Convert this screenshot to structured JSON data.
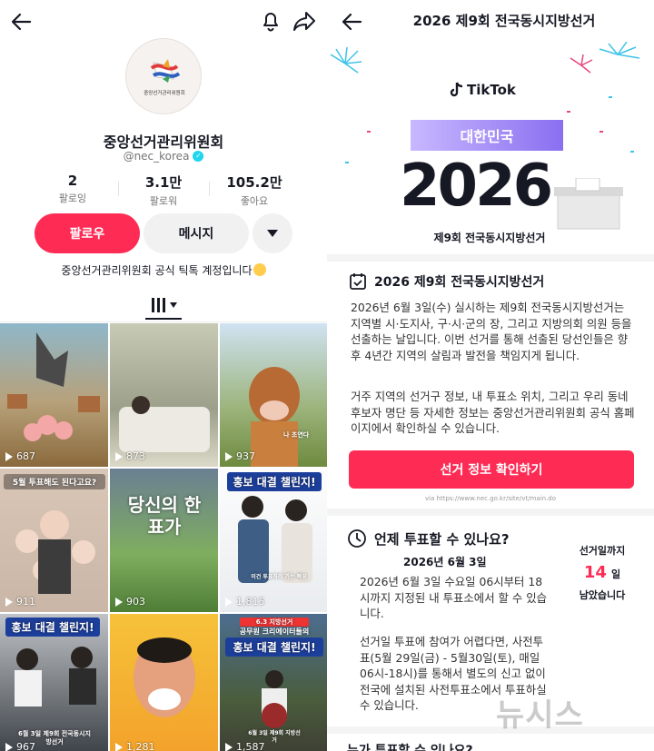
{
  "profile": {
    "name": "중앙선거관리위원회",
    "handle": "@nec_korea",
    "avatar_text": "중앙선거관리위원회",
    "stats": [
      {
        "value": "2",
        "label": "팔로잉"
      },
      {
        "value": "3.1만",
        "label": "팔로워"
      },
      {
        "value": "105.2만",
        "label": "좋아요"
      }
    ],
    "follow_label": "팔로우",
    "message_label": "메시지",
    "bio": "중앙선거관리위원회 공식 틱톡 계정입니다"
  },
  "videos": [
    {
      "views": "687"
    },
    {
      "views": "873"
    },
    {
      "views": "937",
      "caption": "나 초연다"
    },
    {
      "views": "911",
      "caption": "5월 투표해도 된다고요?"
    },
    {
      "views": "903",
      "caption": "당신의 한표가"
    },
    {
      "views": "1,815",
      "title": "홍보 대결 챌린지!",
      "caption": "이건 투표하러 가는 짝꿍"
    },
    {
      "views": "967",
      "title": "홍보 대결 챌린지!",
      "caption": "6월 3일 제9회 전국동시지방선거"
    },
    {
      "views": "1,281"
    },
    {
      "views": "1,587",
      "tag": "6.3 지방선거",
      "subtitle": "공무원 크리에이터들의",
      "title": "홍보 대결 챌린지!",
      "caption": "6월 3일 제9회 지방선거"
    }
  ],
  "event": {
    "page_title": "2026 제9회 전국동시지방선거",
    "brand": "TikTok",
    "banner_country": "대한민국",
    "banner_year": "2026",
    "banner_subtitle": "제9회 전국동시지방선거",
    "section1": {
      "title": "2026 제9회 전국동시지방선거",
      "para1": "2026년 6월 3일(수) 실시하는 제9회 전국동시지방선거는 지역별 시·도지사, 구·시·군의 장, 그리고 지방의회 의원 등을 선출하는 날입니다. 이번 선거를 통해 선출된 당선인들은 향후 4년간 지역의 살림과 발전을 책임지게 됩니다.",
      "para2": "거주 지역의 선거구 정보, 내 투표소 위치, 그리고 우리 동네 후보자 명단 등 자세한 정보는 중앙선거관리위원회 공식 홈페이지에서 확인하실 수 있습니다.",
      "cta": "선거 정보 확인하기",
      "url": "via https://www.nec.go.kr/site/vt/main.do"
    },
    "section2": {
      "title": "언제 투표할 수 있나요?",
      "date": "2026년 6월 3일",
      "para1": "2026년 6월 3일 수요일 06시부터 18시까지 지정된 내 투표소에서 할 수 있습니다.",
      "para2": "선거일 투표에 참여가 어렵다면, 사전투표(5월 29일(금) - 5월30일(토), 매일 06시-18시)를 통해서 별도의 신고 없이 전국에 설치된 사전투표소에서 투표하실 수 있습니다.",
      "dday_prefix": "선거일까지",
      "dday_number": "14",
      "dday_unit": "일",
      "dday_suffix": "남았습니다"
    },
    "section3_title": "누가 투표할 수 있나요?"
  },
  "watermark": "뉴시스",
  "colors": {
    "accent": "#fe2c55",
    "verified": "#20d5ec"
  }
}
